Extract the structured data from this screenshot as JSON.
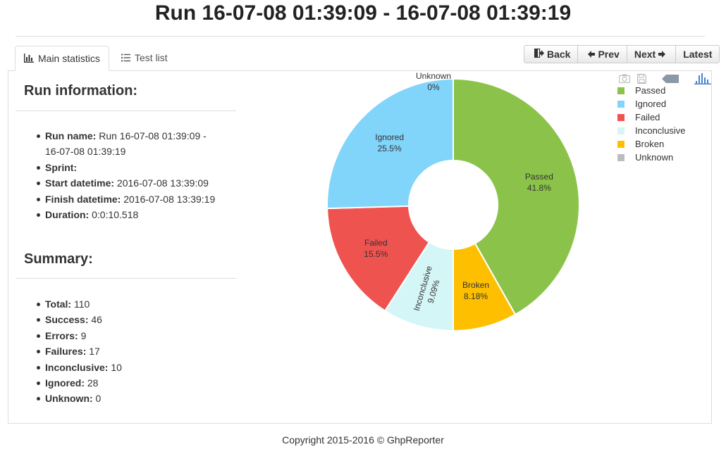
{
  "page": {
    "title": "Run 16-07-08 01:39:09 - 16-07-08 01:39:19"
  },
  "tabs": [
    {
      "label": "Main statistics",
      "icon": "bar-chart-icon"
    },
    {
      "label": "Test list",
      "icon": "list-icon"
    }
  ],
  "nav": {
    "back": "Back",
    "prev": "Prev",
    "next": "Next",
    "latest": "Latest"
  },
  "run_info": {
    "heading": "Run information:",
    "items": [
      {
        "label": "Run name:",
        "value": " Run 16-07-08 01:39:09 -"
      },
      {
        "label": "",
        "value": "16-07-08 01:39:19"
      },
      {
        "label": "Sprint:",
        "value": ""
      },
      {
        "label": "Start datetime:",
        "value": " 2016-07-08 13:39:09"
      },
      {
        "label": "Finish datetime:",
        "value": " 2016-07-08 13:39:19"
      },
      {
        "label": "Duration:",
        "value": " 0:0:10.518"
      }
    ]
  },
  "summary": {
    "heading": "Summary:",
    "items": [
      {
        "label": "Total:",
        "value": " 110"
      },
      {
        "label": "Success:",
        "value": " 46"
      },
      {
        "label": "Errors:",
        "value": " 9"
      },
      {
        "label": "Failures:",
        "value": " 17"
      },
      {
        "label": "Inconclusive:",
        "value": " 10"
      },
      {
        "label": "Ignored:",
        "value": " 28"
      },
      {
        "label": "Unknown:",
        "value": " 0"
      }
    ]
  },
  "chart_tools": [
    "camera-icon",
    "save-icon",
    "tag-icon",
    "histogram-icon"
  ],
  "chart_data": {
    "type": "pie",
    "donut": true,
    "categories": [
      "Passed",
      "Broken",
      "Inconclusive",
      "Failed",
      "Ignored",
      "Unknown"
    ],
    "values": [
      46,
      9,
      10,
      17,
      28,
      0
    ],
    "percent_labels": [
      "41.8%",
      "8.18%",
      "9.09%",
      "15.5%",
      "25.5%",
      "0%"
    ],
    "colors": [
      "#8bc34a",
      "#fdbf00",
      "#d5f6f6",
      "#ef5350",
      "#81d4fa",
      "#bdbdbd"
    ],
    "legend": {
      "position": "top-right",
      "entries": [
        {
          "name": "Passed",
          "color": "#8bc34a"
        },
        {
          "name": "Ignored",
          "color": "#81d4fa"
        },
        {
          "name": "Failed",
          "color": "#ef5350"
        },
        {
          "name": "Inconclusive",
          "color": "#d5f6f6"
        },
        {
          "name": "Broken",
          "color": "#fdbf00"
        },
        {
          "name": "Unknown",
          "color": "#bdbdbd"
        }
      ]
    }
  },
  "footer": {
    "text": "Copyright 2015-2016 © GhpReporter"
  }
}
